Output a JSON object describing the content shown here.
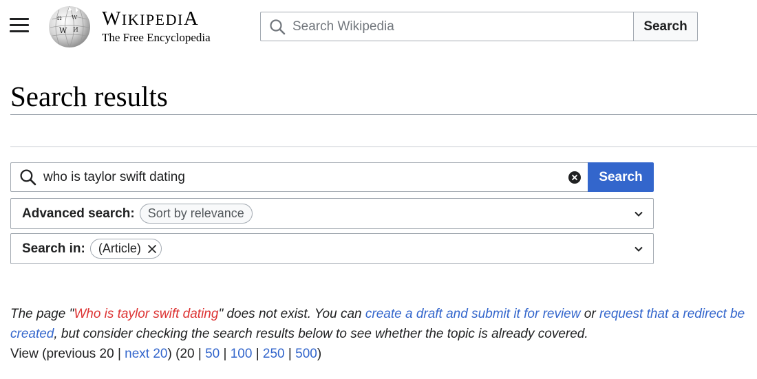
{
  "header": {
    "wordmark_w": "W",
    "wordmark_rest": "IKIPEDI",
    "wordmark_a": "A",
    "tagline": "The Free Encyclopedia",
    "search_placeholder": "Search Wikipedia",
    "search_button": "Search",
    "icons": [
      "menu-icon",
      "wikipedia-globe-logo",
      "search-icon"
    ]
  },
  "page": {
    "title": "Search results"
  },
  "search": {
    "query": "who is taylor swift dating",
    "button": "Search",
    "icons": [
      "search-icon",
      "clear-icon"
    ],
    "button_color": "#3366cc"
  },
  "advanced": {
    "label": "Advanced search:",
    "chip": "Sort by relevance"
  },
  "search_in": {
    "label": "Search in:",
    "chip": "(Article)"
  },
  "message": {
    "p1": "The page \"",
    "red_link": "Who is taylor swift dating",
    "p2": "\" does not exist. You can ",
    "link1": "create a draft and submit it for review",
    "p3": " or ",
    "link2": "request that a redirect be created",
    "p4": ", but consider checking the search results below to see whether the topic is already covered.",
    "red_link_color": "#dd3333",
    "link_color": "#3366cc"
  },
  "paging": {
    "view_prefix": "View (previous 20 | ",
    "next": "next 20",
    "mid": ") (",
    "current": "20",
    "sep": " | ",
    "options": [
      "50",
      "100",
      "250",
      "500"
    ],
    "end": ")"
  }
}
